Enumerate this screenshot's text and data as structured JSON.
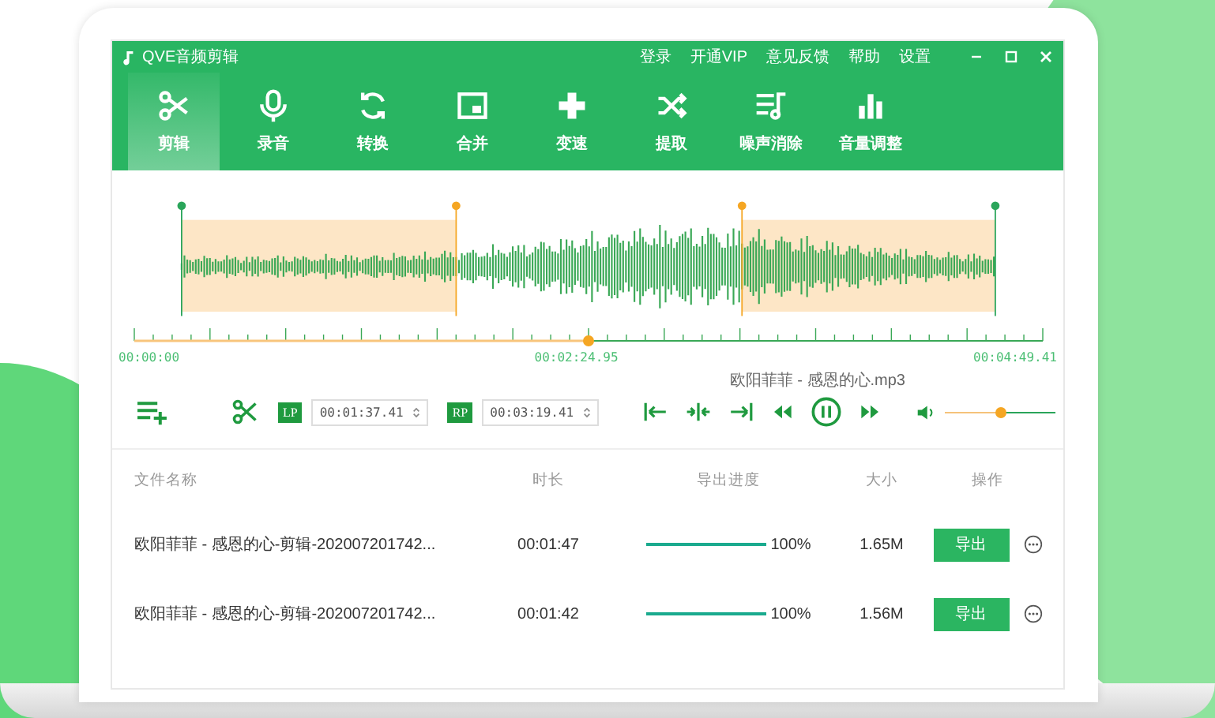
{
  "app": {
    "title": "QVE音频剪辑",
    "menu": [
      "登录",
      "开通VIP",
      "意见反馈",
      "帮助",
      "设置"
    ]
  },
  "tools": [
    {
      "label": "剪辑",
      "selected": true
    },
    {
      "label": "录音",
      "selected": false
    },
    {
      "label": "转换",
      "selected": false
    },
    {
      "label": "合并",
      "selected": false
    },
    {
      "label": "变速",
      "selected": false
    },
    {
      "label": "提取",
      "selected": false
    },
    {
      "label": "噪声消除",
      "selected": false
    },
    {
      "label": "音量调整",
      "selected": false
    }
  ],
  "timeline": {
    "start": "00:00:00",
    "current": "00:02:24.95",
    "end": "00:04:49.41",
    "level": 0.5
  },
  "player": {
    "file_name": "欧阳菲菲 - 感恩的心.mp3",
    "lp_label": "LP",
    "lp_time": "00:01:37.41",
    "rp_label": "RP",
    "rp_time": "00:03:19.41",
    "volume": {
      "level": 0.5
    }
  },
  "table": {
    "columns": [
      "文件名称",
      "时长",
      "导出进度",
      "大小",
      "操作"
    ],
    "rows": [
      {
        "name": "欧阳菲菲 - 感恩的心-剪辑-202007201742...",
        "duration": "00:01:47",
        "progress": {
          "level": 1
        },
        "percent": "100%",
        "size": "1.65M",
        "action": "导出"
      },
      {
        "name": "欧阳菲菲 - 感恩的心-剪辑-202007201742...",
        "duration": "00:01:42",
        "progress": {
          "level": 1
        },
        "percent": "100%",
        "size": "1.56M",
        "action": "导出"
      }
    ]
  }
}
